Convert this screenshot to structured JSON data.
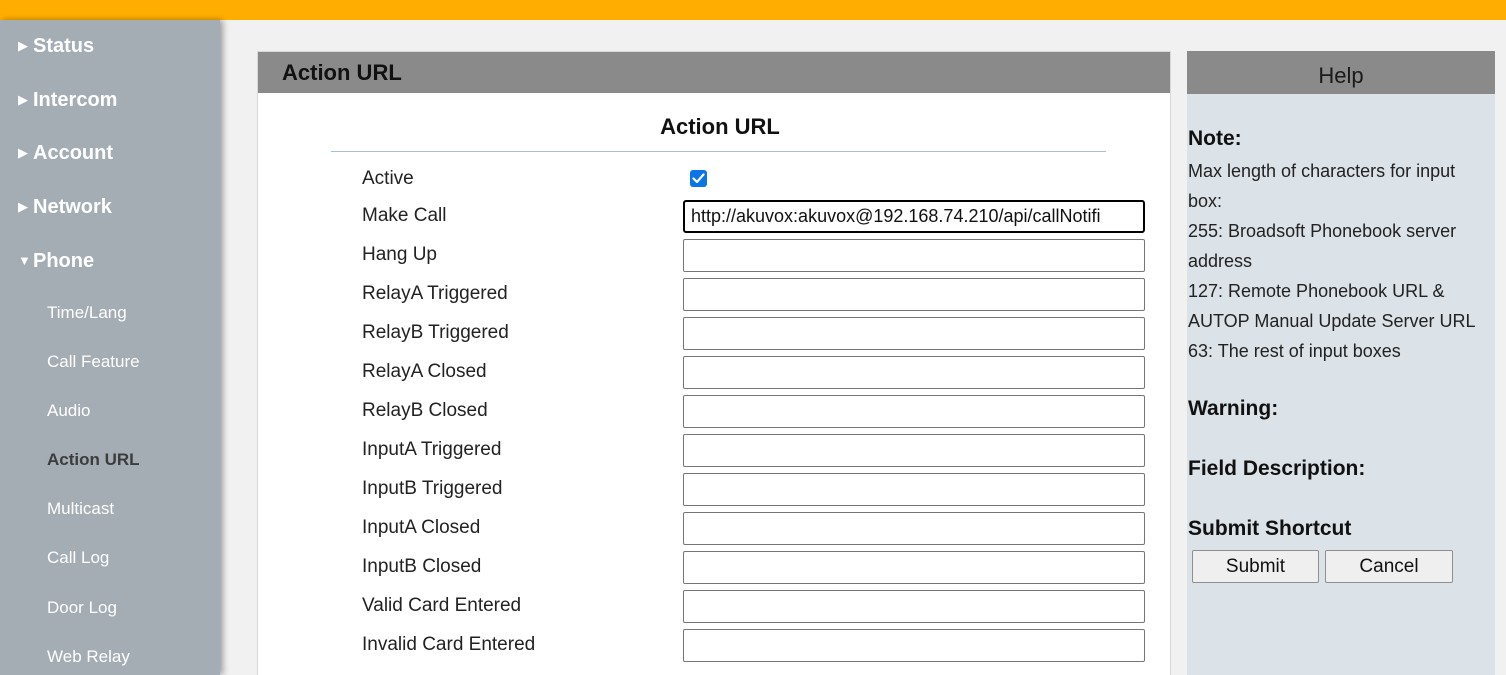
{
  "sidebar": {
    "top_items": [
      {
        "arrow": "▶",
        "label": "Status"
      },
      {
        "arrow": "▶",
        "label": "Intercom"
      },
      {
        "arrow": "▶",
        "label": "Account"
      },
      {
        "arrow": "▶",
        "label": "Network"
      },
      {
        "arrow": "▼",
        "label": "Phone"
      }
    ],
    "sub_items": [
      {
        "label": "Time/Lang"
      },
      {
        "label": "Call Feature"
      },
      {
        "label": "Audio"
      },
      {
        "label": "Action URL",
        "active": true
      },
      {
        "label": "Multicast"
      },
      {
        "label": "Call Log"
      },
      {
        "label": "Door Log"
      },
      {
        "label": "Web Relay"
      }
    ]
  },
  "panel": {
    "header": "Action URL",
    "section_title": "Action URL",
    "active_label": "Active",
    "active_checked": true,
    "fields": [
      {
        "label": "Make Call",
        "value": "http://akuvox:akuvox@192.168.74.210/api/callNotifi"
      },
      {
        "label": "Hang Up",
        "value": ""
      },
      {
        "label": "RelayA Triggered",
        "value": ""
      },
      {
        "label": "RelayB Triggered",
        "value": ""
      },
      {
        "label": "RelayA Closed",
        "value": ""
      },
      {
        "label": "RelayB Closed",
        "value": ""
      },
      {
        "label": "InputA Triggered",
        "value": ""
      },
      {
        "label": "InputB Triggered",
        "value": ""
      },
      {
        "label": "InputA Closed",
        "value": ""
      },
      {
        "label": "InputB Closed",
        "value": ""
      },
      {
        "label": "Valid Card Entered",
        "value": ""
      },
      {
        "label": "Invalid Card Entered",
        "value": ""
      }
    ]
  },
  "help": {
    "title": "Help",
    "note_heading": "Note:",
    "note_lines": [
      "Max length of characters for input box:",
      "255: Broadsoft Phonebook server address",
      "127: Remote Phonebook URL & AUTOP Manual Update Server URL",
      "63: The rest of input boxes"
    ],
    "warning_heading": "Warning:",
    "field_desc_heading": "Field Description:",
    "submit_shortcut_heading": "Submit Shortcut",
    "submit_label": "Submit",
    "cancel_label": "Cancel"
  },
  "colors": {
    "topbar": "#ffae00",
    "sidebar": "#a5adb4",
    "panel_header": "#8a8a8a",
    "help_bg": "#dbe2e8",
    "checkbox": "#0a75e6"
  }
}
